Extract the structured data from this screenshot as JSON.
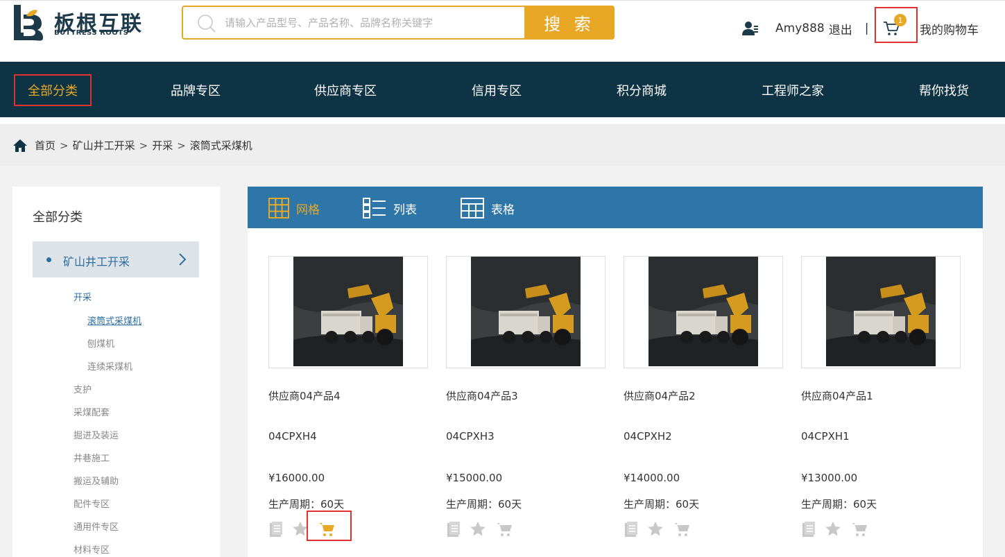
{
  "header": {
    "logo_cn": "板根互联",
    "logo_en": "BUTTRESS ROOTS",
    "search_placeholder": "请输入产品型号、产品名称、品牌名称关键字",
    "search_button": "搜 索",
    "username": "Amy888",
    "logout": "退出",
    "separator": "|",
    "cart_count": "1",
    "cart_label": "我的购物车"
  },
  "nav": {
    "all_categories": "全部分类",
    "items": [
      "品牌专区",
      "供应商专区",
      "信用专区",
      "积分商城",
      "工程师之家",
      "帮你找货"
    ]
  },
  "breadcrumb": {
    "items": [
      "首页",
      "矿山井工开采",
      "开采",
      "滚筒式采煤机"
    ],
    "separator": ">"
  },
  "sidebar": {
    "title": "全部分类",
    "category": "矿山井工开采",
    "subcategory": "开采",
    "sub_items": [
      "滚筒式采煤机",
      "刨煤机",
      "连续采煤机"
    ],
    "other_items": [
      "支护",
      "采煤配套",
      "掘进及装运",
      "井巷施工",
      "搬运及辅助",
      "配件专区",
      "通用件专区",
      "材料专区"
    ]
  },
  "view_tabs": [
    "网格",
    "列表",
    "表格"
  ],
  "products": [
    {
      "name": "供应商04产品4",
      "model": "04CPXH4",
      "price": "¥16000.00",
      "cycle": "生产周期：60天"
    },
    {
      "name": "供应商04产品3",
      "model": "04CPXH3",
      "price": "¥15000.00",
      "cycle": "生产周期：60天"
    },
    {
      "name": "供应商04产品2",
      "model": "04CPXH2",
      "price": "¥14000.00",
      "cycle": "生产周期：60天"
    },
    {
      "name": "供应商04产品1",
      "model": "04CPXH1",
      "price": "¥13000.00",
      "cycle": "生产周期：60天"
    }
  ],
  "colors": {
    "brand_navy": "#0e3344",
    "accent_orange": "#e8a825",
    "view_bar_blue": "#2f76a8",
    "highlight_red": "#e03131"
  },
  "icons": {
    "search": "search-icon",
    "user": "user-icon",
    "cart": "cart-icon",
    "home": "home-icon",
    "grid": "grid-icon",
    "list": "list-icon",
    "table": "table-icon",
    "document": "document-icon",
    "star": "star-icon"
  }
}
